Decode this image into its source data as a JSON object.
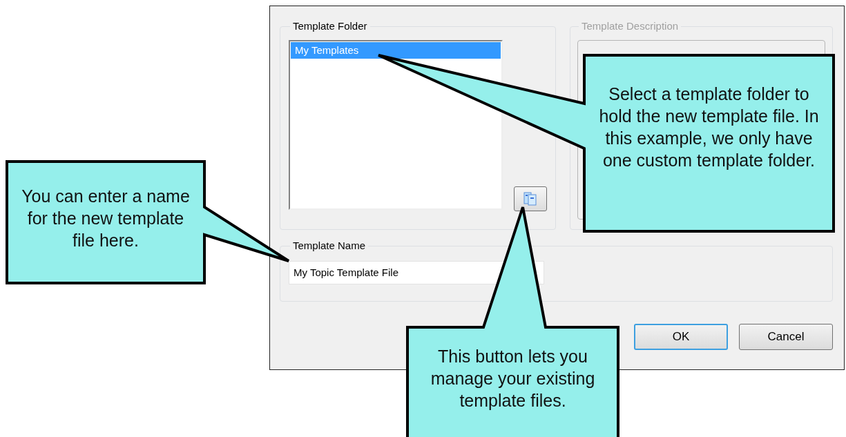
{
  "folder_group": {
    "label": "Template Folder",
    "items": [
      {
        "label": "My Templates",
        "selected": true
      }
    ]
  },
  "description_group": {
    "label": "Template Description",
    "disabled": true
  },
  "name_group": {
    "label": "Template Name",
    "value": "My Topic Template File"
  },
  "buttons": [
    {
      "label": "OK",
      "default": true
    },
    {
      "label": "Cancel",
      "default": false
    }
  ],
  "callouts": [
    {
      "text": "Select a template folder to hold the new template file. In this example, we only have one custom template folder."
    },
    {
      "text": "You can enter a name for the new template file here."
    },
    {
      "text": "This button lets you manage your existing template files."
    }
  ]
}
